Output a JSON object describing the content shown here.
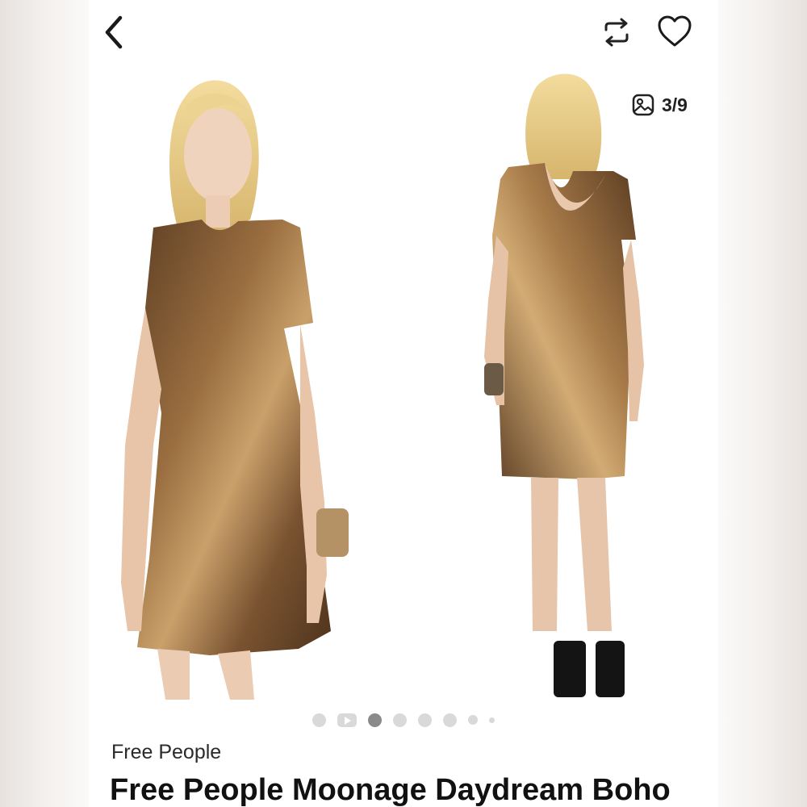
{
  "counter": {
    "text": "3/9"
  },
  "listing": {
    "brand": "Free People",
    "title": "Free People Moonage Daydream Boho"
  },
  "icons": {
    "back": "chevron-left-icon",
    "repost": "repost-icon",
    "like": "heart-icon",
    "gallery": "image-icon"
  },
  "carousel": {
    "total_images": 9,
    "current_image": 3
  },
  "colors": {
    "dress": "#7a5331",
    "dot_active": "#8a8a8a",
    "dot": "#d9d9d9"
  }
}
